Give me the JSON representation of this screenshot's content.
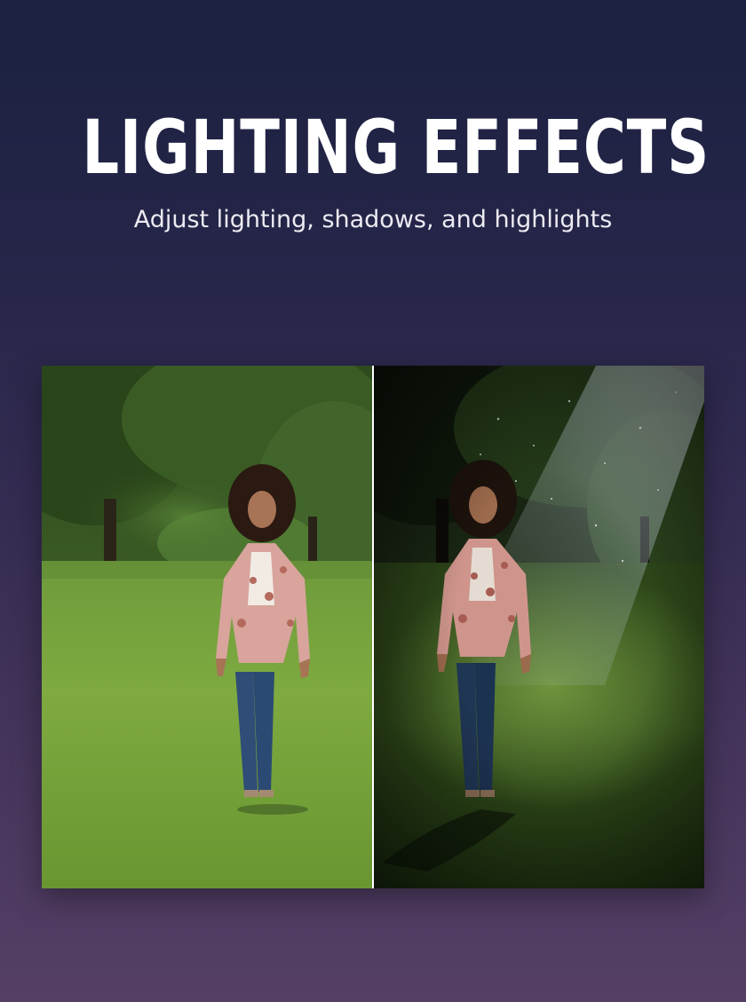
{
  "header": {
    "title": "LIGHTING EFFECTS",
    "subtitle": "Adjust lighting, shadows, and highlights"
  },
  "comparison": {
    "before": {
      "scene": "woman standing on grass in park, natural daylight"
    },
    "after": {
      "scene": "same scene with dramatic spotlight beam and darkened surroundings"
    }
  },
  "colors": {
    "background_top": "#1b2140",
    "background_bottom": "#553f65",
    "title": "#ffffff",
    "divider": "#ffffff"
  }
}
